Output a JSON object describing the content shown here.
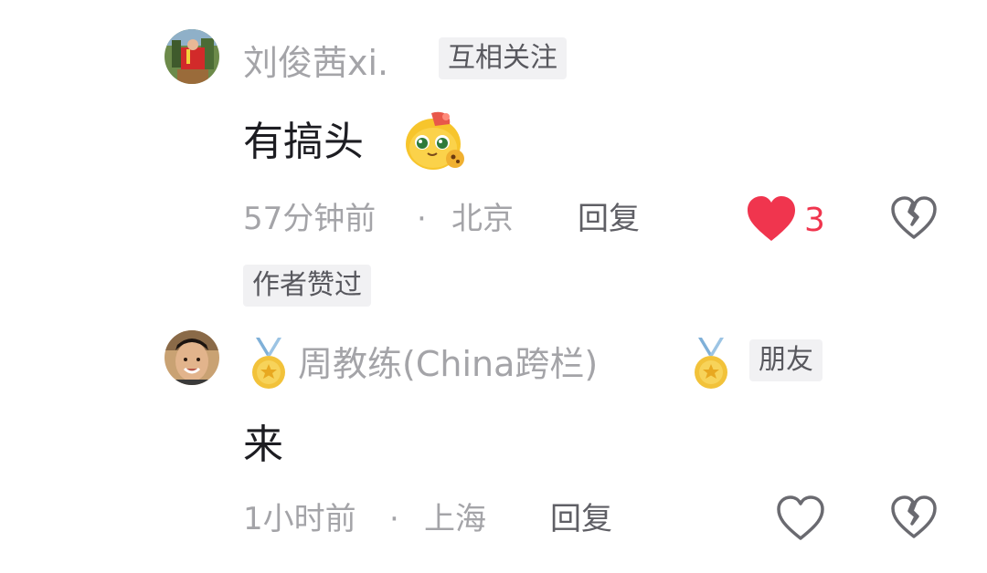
{
  "comments": [
    {
      "author": "刘俊茜xi.",
      "relation_badge": "互相关注",
      "text": "有搞头",
      "emoji_icon": "cute-blob-sticker-icon",
      "time": "57分钟前",
      "location": "北京",
      "separator": "·",
      "reply_label": "回复",
      "liked": true,
      "like_count": "3",
      "author_liked_badge": "作者赞过"
    },
    {
      "author": "周教练(China跨栏)",
      "relation_badge": "朋友",
      "name_icons": [
        "gold-medal-icon",
        "gold-medal-icon"
      ],
      "text": "来",
      "time": "1小时前",
      "location": "上海",
      "separator": "·",
      "reply_label": "回复",
      "liked": false
    }
  ],
  "colors": {
    "like_red": "#f0354e",
    "name_gray": "#a4a4a8",
    "text_dark": "#1d1d22",
    "badge_bg": "#f1f1f3"
  }
}
